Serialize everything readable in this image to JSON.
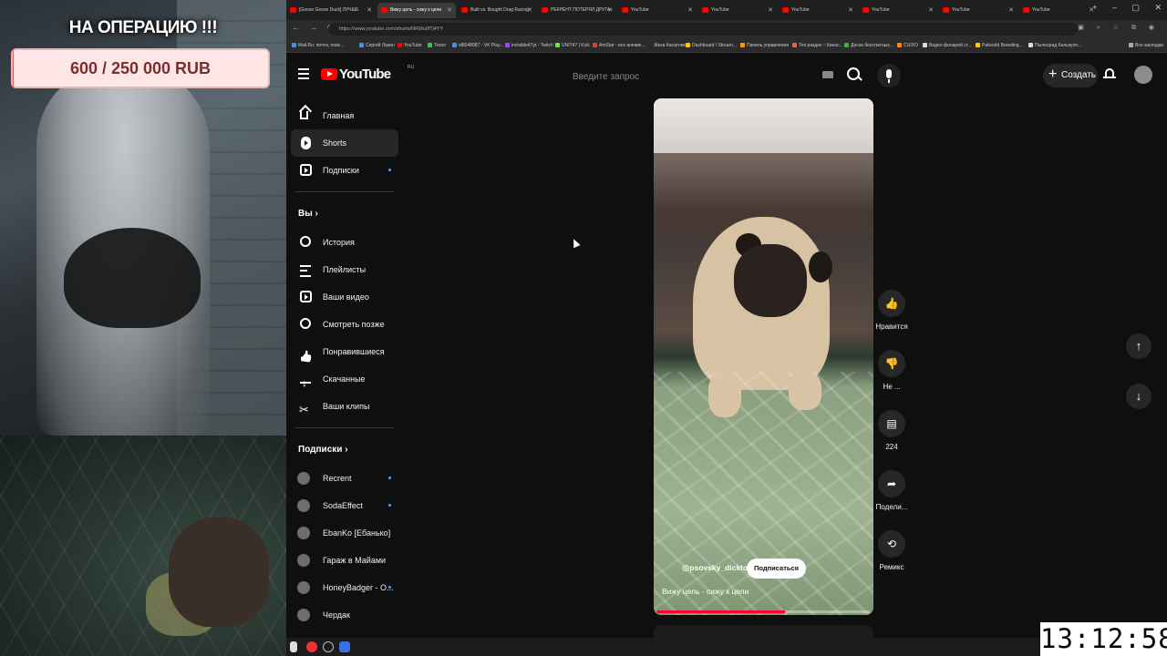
{
  "overlay": {
    "donate_title": "НА ОПЕРАЦИЮ !!!",
    "donate_amount": "600 / 250 000 RUB",
    "donate_progress": 0.0024
  },
  "browser": {
    "tabs": [
      {
        "label": "[Goose Goose Duck] ЛУЧШЕ"
      },
      {
        "label": "Вижу цель - сижу к цели"
      },
      {
        "label": "Built vs. Bought Drag Racing"
      },
      {
        "label": "РЕКРЕНТ ПОТЕРЯЛ ДРУГА -"
      },
      {
        "label": "YouTube"
      },
      {
        "label": "YouTube"
      },
      {
        "label": "YouTube"
      },
      {
        "label": "YouTube"
      },
      {
        "label": "YouTube"
      },
      {
        "label": "YouTube"
      }
    ],
    "url": "https://www.youtube.com/shorts/NRMu0fTj4YY",
    "bookmarks": [
      "Mail.Ru: почта, поис...",
      "Сергей Лазин",
      "YouTube",
      "Treno",
      "id8048987 - VK Play...",
      "invisible47yt - Twitch",
      "UNIT47 | Kick",
      "AmStar - все анекие...",
      "Жека Касатник",
      "Dashboard / Stream...",
      "Панель управления",
      "Топ раздач :: Кинос...",
      "Доска бесплатных...",
      "CUIXO",
      "Видео фонарей ст...",
      "Palworld Breeding...",
      "Пылеорад Калькуля...",
      "Все закладки"
    ]
  },
  "youtube": {
    "logo_text": "YouTube",
    "logo_country": "RU",
    "search_placeholder": "Введите запрос",
    "create_label": "Создать",
    "sidebar": {
      "main": [
        {
          "label": "Главная"
        },
        {
          "label": "Shorts"
        },
        {
          "label": "Подписки"
        }
      ],
      "you_title": "Вы",
      "you_items": [
        {
          "label": "История"
        },
        {
          "label": "Плейлисты"
        },
        {
          "label": "Ваши видео"
        },
        {
          "label": "Смотреть позже"
        },
        {
          "label": "Понравившиеся"
        },
        {
          "label": "Скачанные"
        },
        {
          "label": "Ваши клипы"
        }
      ],
      "subs_title": "Подписки",
      "subs": [
        {
          "label": "Recrent"
        },
        {
          "label": "SodaEffect"
        },
        {
          "label": "EbanKo [Ебанько]"
        },
        {
          "label": "Гараж в Майами"
        },
        {
          "label": "HoneyBadger - O..."
        },
        {
          "label": "Чердак"
        }
      ]
    },
    "short": {
      "channel": "@psovsky_dicktor",
      "subscribe_label": "Подписаться",
      "title": "Вижу цель - сижу к цели",
      "progress": 0.6
    },
    "actions": {
      "like_label": "Нравится",
      "dislike_label": "Не ...",
      "comments_count": "224",
      "share_label": "Подели...",
      "remix_label": "Ремикс"
    }
  },
  "clock": "13:12:58"
}
